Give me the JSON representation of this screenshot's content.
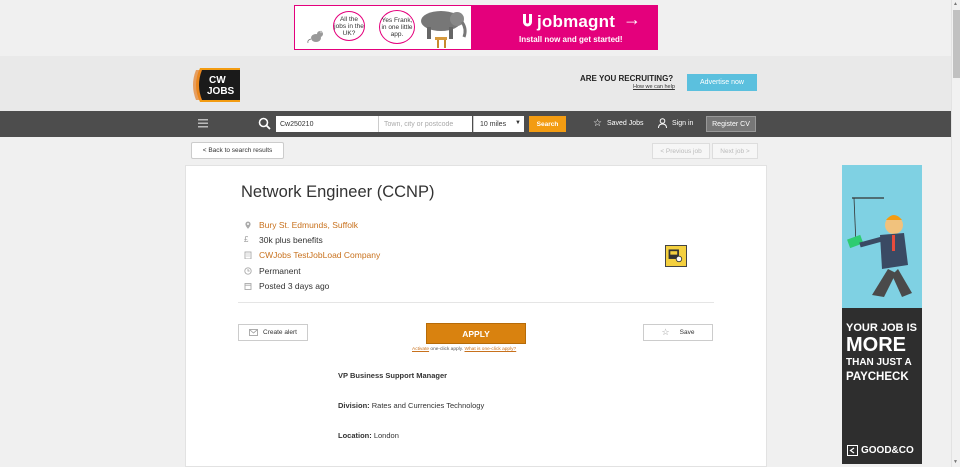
{
  "top_ad": {
    "bubble_1": "All the jobs in the UK?",
    "bubble_2": "Yes Frank, in one little app.",
    "brand": "jobmagnt",
    "tagline": "Install now and get started!",
    "brand_color": "#e4007c"
  },
  "header": {
    "logo_text_1": "CW",
    "logo_text_2": "JOBS",
    "recruiting_title": "ARE YOU RECRUITING?",
    "recruiting_link": "How we can help",
    "advertise_label": "Advertise now"
  },
  "navbar": {
    "search_value": "Cw250210",
    "location_placeholder": "Town, city or postcode",
    "radius_value": "10 miles",
    "search_label": "Search",
    "saved_jobs_label": "Saved Jobs",
    "signin_label": "Sign in",
    "register_label": "Register CV",
    "accent_color": "#f39c12"
  },
  "subnav": {
    "back_label": "< Back to search results",
    "prev_label": "< Previous job",
    "next_label": "Next job >"
  },
  "job": {
    "title": "Network Engineer (CCNP)",
    "location": "Bury St. Edmunds, Suffolk",
    "salary": "30k plus benefits",
    "company": "CWJobs TestJobLoad Company",
    "job_type": "Permanent",
    "posted": "Posted 3 days ago",
    "link_color": "#c8711d"
  },
  "actions": {
    "create_alert_label": "Create alert",
    "apply_label": "APPLY",
    "apply_note_link1": "Activate",
    "apply_note_text": "one-click apply.",
    "apply_note_link2": "What is one-click apply?",
    "save_label": "Save"
  },
  "description": {
    "heading": "VP Business Support Manager",
    "division_label": "Division:",
    "division_value": "Rates and Currencies Technology",
    "location_label": "Location:",
    "location_value": "London"
  },
  "side_ad": {
    "line1": "YOUR JOB IS",
    "line2": "MORE",
    "line3": "THAN JUST A",
    "line4": "PAYCHECK",
    "brand": "GOOD&CO"
  }
}
